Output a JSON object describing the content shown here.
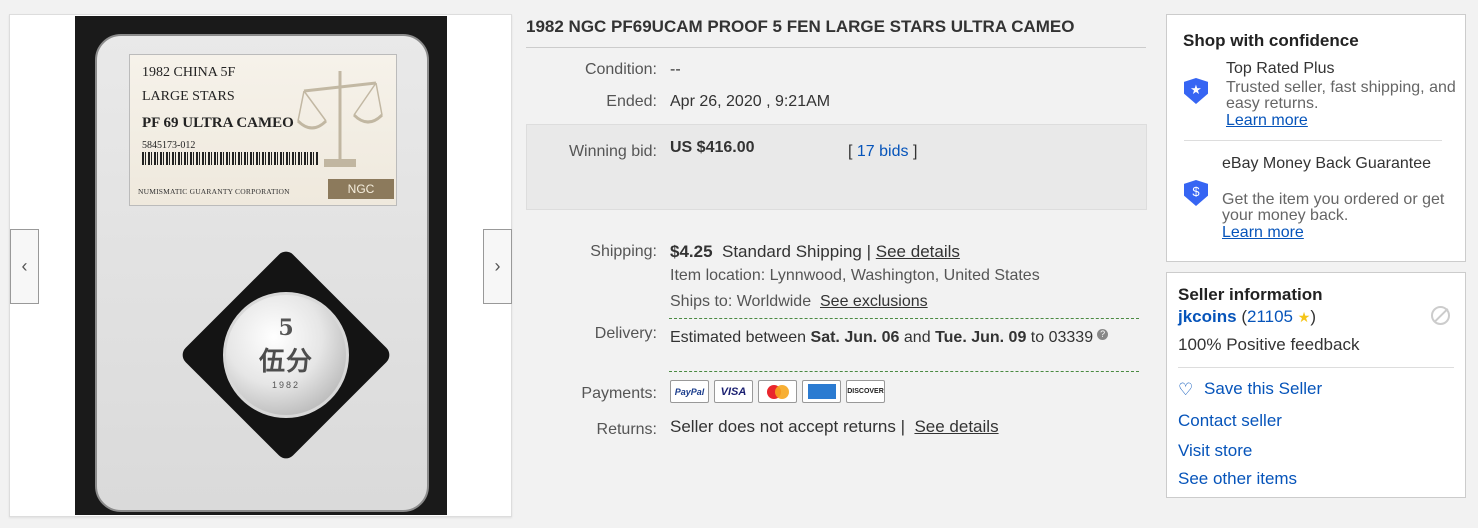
{
  "gallery": {
    "prev_arrow": "‹",
    "next_arrow": "›",
    "slab_label": {
      "line1": "1982 CHINA 5F",
      "line2": "LARGE STARS",
      "line3": "PF 69 ULTRA CAMEO",
      "cert": "5845173-012",
      "org": "NUMISMATIC GUARANTY CORPORATION",
      "logo": "NGC"
    },
    "coin": {
      "numeral": "5",
      "chars": "伍分",
      "year": "1982"
    }
  },
  "listing": {
    "title": "1982 NGC PF69UCAM PROOF 5 FEN LARGE STARS ULTRA CAMEO",
    "condition_label": "Condition:",
    "condition_value": "--",
    "ended_label": "Ended:",
    "ended_value": "Apr 26, 2020 , 9:21AM",
    "winning_bid_label": "Winning bid:",
    "winning_bid_value": "US $416.00",
    "bids_open": "[",
    "bids_link": "17 bids",
    "bids_close": "]",
    "shipping_label": "Shipping:",
    "shipping_cost": "$4.25",
    "shipping_method": "Standard Shipping |",
    "shipping_details_link": "See details",
    "item_location": "Item location: Lynnwood, Washington, United States",
    "ships_to": "Ships to: Worldwide",
    "see_exclusions_link": "See exclusions",
    "delivery_label": "Delivery:",
    "delivery_pre": "Estimated between",
    "delivery_start": "Sat. Jun. 06",
    "delivery_and": "and",
    "delivery_end": "Tue. Jun. 09",
    "delivery_to": "to",
    "delivery_zip": "03339",
    "payments_label": "Payments:",
    "payment_methods": [
      "PayPal",
      "VISA",
      "MasterCard",
      "American Express",
      "DISCOVER"
    ],
    "returns_label": "Returns:",
    "returns_value": "Seller does not accept returns |",
    "returns_details_link": "See details"
  },
  "confidence": {
    "title": "Shop with confidence",
    "top_rated_title": "Top Rated Plus",
    "top_rated_text": "Trusted seller, fast shipping, and easy returns.",
    "top_rated_link": "Learn more",
    "mbg_title": "eBay Money Back Guarantee",
    "mbg_text": "Get the item you ordered or get your money back.",
    "mbg_link": "Learn more",
    "top_rated_icon": "star-shield-icon",
    "mbg_icon": "dollar-shield-icon"
  },
  "seller": {
    "title": "Seller information",
    "username": "jkcoins",
    "feedback_open": "(",
    "feedback_score": "21105",
    "feedback_close": ")",
    "positive_feedback": "100% Positive feedback",
    "save_seller": "Save this Seller",
    "contact_seller": "Contact seller",
    "visit_store": "Visit store",
    "see_other_items": "See other items"
  },
  "colors": {
    "link": "#0654ba",
    "shield": "#3665f3",
    "delivery_divider": "#4a8a42"
  }
}
